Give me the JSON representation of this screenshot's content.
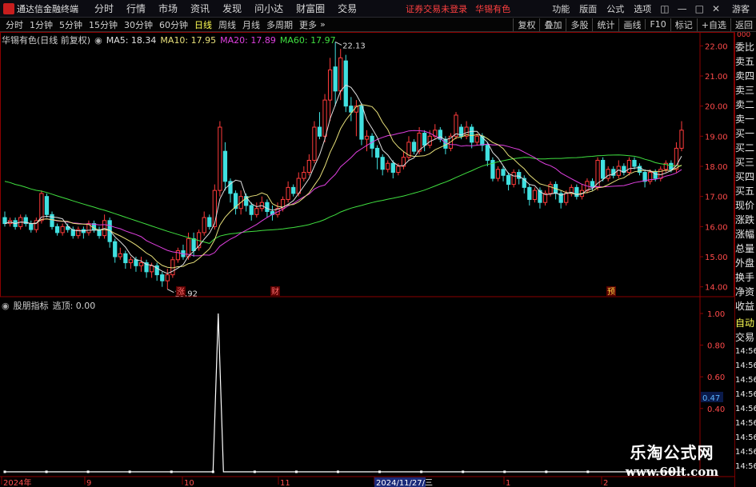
{
  "app": {
    "title": "通达信金融终端"
  },
  "menu": [
    "分时",
    "行情",
    "市场",
    "资讯",
    "发现",
    "问小达",
    "财富圈",
    "交易"
  ],
  "status": {
    "trade_login": "证券交易未登录",
    "stock_name": "华锡有色"
  },
  "right_menu": [
    "功能",
    "版面",
    "公式",
    "选项"
  ],
  "guest": "游客",
  "timeframes": {
    "items": [
      "分时",
      "1分钟",
      "5分钟",
      "15分钟",
      "30分钟",
      "60分钟",
      "日线",
      "周线",
      "月线",
      "多周期",
      "更多"
    ],
    "active": "日线"
  },
  "tool_buttons": [
    "复权",
    "叠加",
    "多股",
    "统计",
    "画线",
    "F10",
    "标记",
    "+自选",
    "返回"
  ],
  "main_legend": {
    "title": "华锡有色(日线 前复权)",
    "ma": [
      {
        "label": "MA5: 18.34",
        "color": "#e0e0e0"
      },
      {
        "label": "MA10: 17.95",
        "color": "#e8e07a"
      },
      {
        "label": "MA20: 17.89",
        "color": "#e040e0"
      },
      {
        "label": "MA60: 17.97",
        "color": "#40e040"
      }
    ]
  },
  "indicator_legend": {
    "name": "股朋指标",
    "value_label": "逃顶: 0.00"
  },
  "price_axis": [
    "22.00",
    "21.00",
    "20.00",
    "19.00",
    "18.00",
    "17.00",
    "16.00",
    "15.00",
    "14.00"
  ],
  "indicator_axis": [
    "1.00",
    "0.80",
    "0.60",
    "0.40"
  ],
  "indicator_current": "0.47",
  "annotations": {
    "high": "22.13",
    "low": "13.92"
  },
  "event_markers": [
    "涨",
    "财",
    "预"
  ],
  "date_axis": [
    {
      "label": "2024年",
      "highlight": false
    },
    {
      "label": "9",
      "highlight": false
    },
    {
      "label": "10",
      "highlight": false
    },
    {
      "label": "11",
      "highlight": false
    },
    {
      "label": "2024/11/27/三",
      "highlight": true
    },
    {
      "label": "1",
      "highlight": false
    },
    {
      "label": "2",
      "highlight": false
    }
  ],
  "side_panel": {
    "top_tag": "000",
    "items": [
      "委比",
      "卖五",
      "卖四",
      "卖三",
      "卖二",
      "卖一",
      "买一",
      "买二",
      "买三",
      "买四",
      "买五",
      "现价",
      "涨跌",
      "涨幅",
      "总量",
      "外盘",
      "换手",
      "净资",
      "收益"
    ],
    "lower_items": [
      "自动",
      "交易",
      "14:56",
      "14:56",
      "14:56",
      "14:56",
      "14:56",
      "14:56",
      "14:56",
      "14:56",
      "14:56"
    ]
  },
  "watermark": {
    "title": "乐淘公式网",
    "url": "www.60lt.com"
  },
  "colors": {
    "up": "#ff3b3b",
    "down": "#40e0e0",
    "ma5": "#e0e0e0",
    "ma10": "#e8e07a",
    "ma20": "#e040e0",
    "ma60": "#40e040",
    "indicator": "#ffffff",
    "frame": "#8b0000"
  },
  "chart_data": [
    {
      "type": "candlestick",
      "title": "华锡有色(日线 前复权)",
      "ylim": [
        13.7,
        22.3
      ],
      "yticks": [
        14,
        15,
        16,
        17,
        18,
        19,
        20,
        21,
        22
      ],
      "series": [
        {
          "name": "MA5",
          "values": []
        },
        {
          "name": "MA10",
          "values": []
        },
        {
          "name": "MA20",
          "values": []
        },
        {
          "name": "MA60",
          "values": []
        }
      ],
      "candles": [
        [
          16.3,
          16.1,
          16.5,
          16.0
        ],
        [
          16.1,
          16.2,
          16.3,
          16.0
        ],
        [
          16.2,
          16.0,
          16.3,
          15.9
        ],
        [
          16.0,
          16.3,
          16.4,
          15.9
        ],
        [
          16.3,
          16.1,
          16.4,
          16.0
        ],
        [
          16.1,
          15.9,
          16.2,
          15.8
        ],
        [
          15.9,
          16.2,
          16.3,
          15.8
        ],
        [
          16.2,
          17.1,
          17.2,
          16.1
        ],
        [
          17.0,
          16.4,
          17.1,
          16.3
        ],
        [
          16.4,
          16.0,
          16.5,
          15.9
        ],
        [
          16.0,
          15.8,
          16.1,
          15.7
        ],
        [
          15.8,
          16.0,
          16.1,
          15.7
        ],
        [
          16.0,
          15.9,
          16.1,
          15.8
        ],
        [
          15.9,
          15.7,
          16.0,
          15.6
        ],
        [
          15.7,
          15.9,
          16.0,
          15.6
        ],
        [
          15.9,
          15.8,
          16.0,
          15.6
        ],
        [
          15.8,
          16.1,
          16.2,
          15.7
        ],
        [
          16.1,
          15.9,
          16.2,
          15.8
        ],
        [
          15.9,
          15.7,
          16.0,
          15.6
        ],
        [
          15.7,
          16.2,
          16.4,
          15.6
        ],
        [
          16.2,
          15.5,
          16.3,
          15.3
        ],
        [
          15.5,
          15.0,
          15.6,
          14.8
        ],
        [
          15.0,
          15.1,
          15.3,
          14.9
        ],
        [
          15.1,
          14.8,
          15.2,
          14.6
        ],
        [
          14.8,
          14.9,
          15.0,
          14.6
        ],
        [
          14.9,
          14.7,
          15.0,
          14.5
        ],
        [
          14.7,
          14.8,
          15.0,
          14.5
        ],
        [
          14.8,
          14.5,
          14.9,
          14.3
        ],
        [
          14.5,
          14.7,
          14.8,
          14.3
        ],
        [
          14.7,
          14.4,
          14.8,
          14.2
        ],
        [
          14.4,
          14.2,
          14.5,
          14.0
        ],
        [
          14.2,
          14.4,
          14.6,
          13.92
        ],
        [
          14.4,
          14.9,
          15.0,
          14.3
        ],
        [
          14.9,
          15.2,
          15.3,
          14.8
        ],
        [
          15.2,
          15.0,
          15.4,
          14.9
        ],
        [
          15.0,
          15.6,
          15.8,
          14.9
        ],
        [
          15.6,
          15.2,
          15.8,
          15.0
        ],
        [
          15.3,
          15.8,
          15.9,
          15.2
        ],
        [
          15.8,
          16.3,
          16.5,
          15.7
        ],
        [
          16.3,
          16.0,
          16.4,
          15.9
        ],
        [
          16.0,
          17.2,
          17.4,
          15.9
        ],
        [
          17.2,
          19.3,
          19.5,
          17.0
        ],
        [
          18.5,
          17.5,
          18.8,
          17.2
        ],
        [
          17.5,
          17.1,
          17.6,
          16.8
        ],
        [
          17.1,
          16.6,
          17.2,
          16.4
        ],
        [
          16.6,
          17.0,
          17.2,
          16.4
        ],
        [
          17.0,
          16.7,
          17.1,
          16.5
        ],
        [
          16.7,
          16.4,
          16.8,
          16.2
        ],
        [
          16.4,
          16.6,
          16.8,
          16.3
        ],
        [
          16.6,
          16.8,
          17.0,
          16.5
        ],
        [
          16.8,
          16.5,
          16.9,
          16.3
        ],
        [
          16.5,
          16.4,
          16.7,
          16.2
        ],
        [
          16.4,
          16.6,
          16.8,
          16.3
        ],
        [
          16.6,
          16.9,
          17.0,
          16.5
        ],
        [
          16.9,
          17.3,
          17.5,
          16.8
        ],
        [
          17.3,
          17.1,
          17.4,
          17.0
        ],
        [
          17.1,
          17.6,
          17.8,
          17.0
        ],
        [
          17.6,
          17.8,
          18.0,
          17.5
        ],
        [
          17.8,
          18.2,
          18.4,
          17.7
        ],
        [
          18.2,
          19.3,
          19.5,
          18.1
        ],
        [
          19.3,
          19.0,
          19.8,
          18.9
        ],
        [
          19.0,
          20.2,
          20.4,
          18.8
        ],
        [
          20.2,
          21.2,
          21.6,
          19.5
        ],
        [
          21.3,
          20.5,
          22.13,
          20.0
        ],
        [
          20.5,
          21.6,
          21.9,
          20.2
        ],
        [
          21.5,
          20.0,
          21.7,
          19.8
        ],
        [
          20.0,
          19.8,
          20.3,
          19.5
        ],
        [
          19.8,
          20.0,
          20.2,
          19.0
        ],
        [
          20.0,
          18.9,
          20.1,
          18.7
        ],
        [
          18.9,
          19.0,
          19.2,
          18.5
        ],
        [
          19.0,
          18.6,
          19.1,
          18.3
        ],
        [
          18.6,
          18.3,
          18.7,
          17.9
        ],
        [
          18.3,
          17.9,
          18.4,
          17.7
        ],
        [
          17.9,
          18.1,
          18.2,
          17.8
        ],
        [
          18.1,
          17.8,
          18.2,
          17.6
        ],
        [
          17.8,
          18.0,
          18.1,
          17.7
        ],
        [
          18.0,
          18.3,
          18.5,
          17.9
        ],
        [
          18.3,
          18.8,
          19.0,
          18.2
        ],
        [
          18.8,
          18.5,
          18.9,
          18.4
        ],
        [
          18.5,
          19.1,
          19.3,
          18.4
        ],
        [
          19.1,
          18.7,
          19.2,
          18.5
        ],
        [
          18.7,
          19.0,
          19.2,
          18.6
        ],
        [
          19.0,
          19.2,
          19.4,
          18.9
        ],
        [
          19.2,
          18.9,
          19.3,
          18.8
        ],
        [
          18.9,
          18.6,
          19.0,
          18.4
        ],
        [
          18.6,
          19.0,
          19.1,
          18.5
        ],
        [
          19.0,
          19.7,
          19.8,
          18.9
        ],
        [
          19.3,
          19.0,
          19.4,
          18.9
        ],
        [
          19.0,
          19.3,
          19.5,
          18.9
        ],
        [
          19.3,
          18.8,
          19.4,
          18.6
        ],
        [
          18.8,
          19.0,
          19.1,
          18.7
        ],
        [
          19.0,
          18.7,
          19.1,
          18.5
        ],
        [
          18.7,
          18.2,
          18.8,
          18.0
        ],
        [
          18.2,
          17.6,
          18.3,
          17.5
        ],
        [
          17.6,
          17.9,
          18.0,
          17.5
        ],
        [
          17.9,
          17.7,
          18.0,
          17.5
        ],
        [
          17.7,
          17.4,
          17.8,
          17.2
        ],
        [
          17.4,
          17.8,
          17.9,
          17.3
        ],
        [
          17.8,
          17.6,
          17.9,
          17.4
        ],
        [
          17.6,
          17.3,
          17.7,
          17.1
        ],
        [
          17.3,
          16.9,
          17.4,
          16.7
        ],
        [
          16.9,
          17.2,
          17.3,
          16.8
        ],
        [
          17.2,
          16.8,
          17.3,
          16.6
        ],
        [
          16.8,
          17.1,
          17.2,
          16.7
        ],
        [
          17.1,
          17.4,
          17.5,
          17.0
        ],
        [
          17.4,
          17.1,
          17.5,
          16.9
        ],
        [
          17.1,
          16.8,
          17.2,
          16.6
        ],
        [
          16.8,
          17.1,
          17.2,
          16.7
        ],
        [
          17.1,
          17.3,
          17.4,
          17.0
        ],
        [
          17.3,
          17.0,
          17.4,
          16.9
        ],
        [
          17.0,
          17.2,
          17.4,
          16.9
        ],
        [
          17.2,
          17.5,
          17.6,
          17.1
        ],
        [
          17.5,
          17.3,
          17.6,
          17.2
        ],
        [
          17.3,
          18.2,
          18.3,
          17.2
        ],
        [
          18.2,
          17.6,
          18.3,
          17.5
        ],
        [
          17.6,
          17.9,
          18.0,
          17.5
        ],
        [
          17.9,
          17.7,
          18.0,
          17.6
        ],
        [
          17.7,
          18.0,
          18.2,
          17.6
        ],
        [
          18.0,
          17.8,
          18.1,
          17.7
        ],
        [
          17.8,
          18.2,
          18.3,
          17.7
        ],
        [
          18.2,
          18.0,
          18.3,
          17.9
        ],
        [
          18.0,
          17.8,
          18.1,
          17.7
        ],
        [
          17.8,
          17.5,
          17.9,
          17.3
        ],
        [
          17.5,
          17.8,
          17.9,
          17.4
        ],
        [
          17.8,
          17.6,
          17.9,
          17.5
        ],
        [
          17.6,
          17.9,
          18.0,
          17.5
        ],
        [
          17.9,
          18.1,
          18.2,
          17.8
        ],
        [
          18.1,
          17.9,
          18.2,
          17.8
        ],
        [
          17.9,
          18.6,
          18.8,
          17.8
        ],
        [
          18.6,
          19.2,
          19.5,
          18.5
        ]
      ]
    },
    {
      "type": "line",
      "title": "股朋指标",
      "ylim": [
        0,
        1.0
      ],
      "series": [
        {
          "name": "逃顶",
          "values": [
            0,
            0,
            0,
            0,
            0,
            0,
            0,
            0,
            0,
            0,
            0,
            0,
            0,
            0,
            0,
            0,
            0,
            0,
            0,
            0,
            0,
            0,
            0,
            0,
            0,
            0,
            0,
            0,
            0,
            0,
            0,
            0,
            0,
            0,
            0,
            0,
            0,
            0,
            0,
            0,
            0,
            1,
            0,
            0,
            0,
            0,
            0,
            0,
            0,
            0,
            0,
            0,
            0,
            0,
            0,
            0,
            0,
            0,
            0,
            0,
            0,
            0,
            0,
            0,
            0,
            0,
            0,
            0,
            0,
            0,
            0,
            0,
            0,
            0,
            0,
            0,
            0,
            0,
            0,
            0,
            0,
            0,
            0,
            0,
            0,
            0,
            0,
            0,
            0,
            0,
            0,
            0,
            0,
            0,
            0,
            0,
            0,
            0,
            0,
            0,
            0,
            0,
            0,
            0,
            0,
            0,
            0,
            0,
            0,
            0,
            0,
            0,
            0,
            0,
            0,
            0,
            0,
            0,
            0,
            0,
            0,
            0,
            0,
            0,
            0,
            0,
            0,
            0,
            0,
            0,
            0
          ]
        }
      ]
    }
  ]
}
